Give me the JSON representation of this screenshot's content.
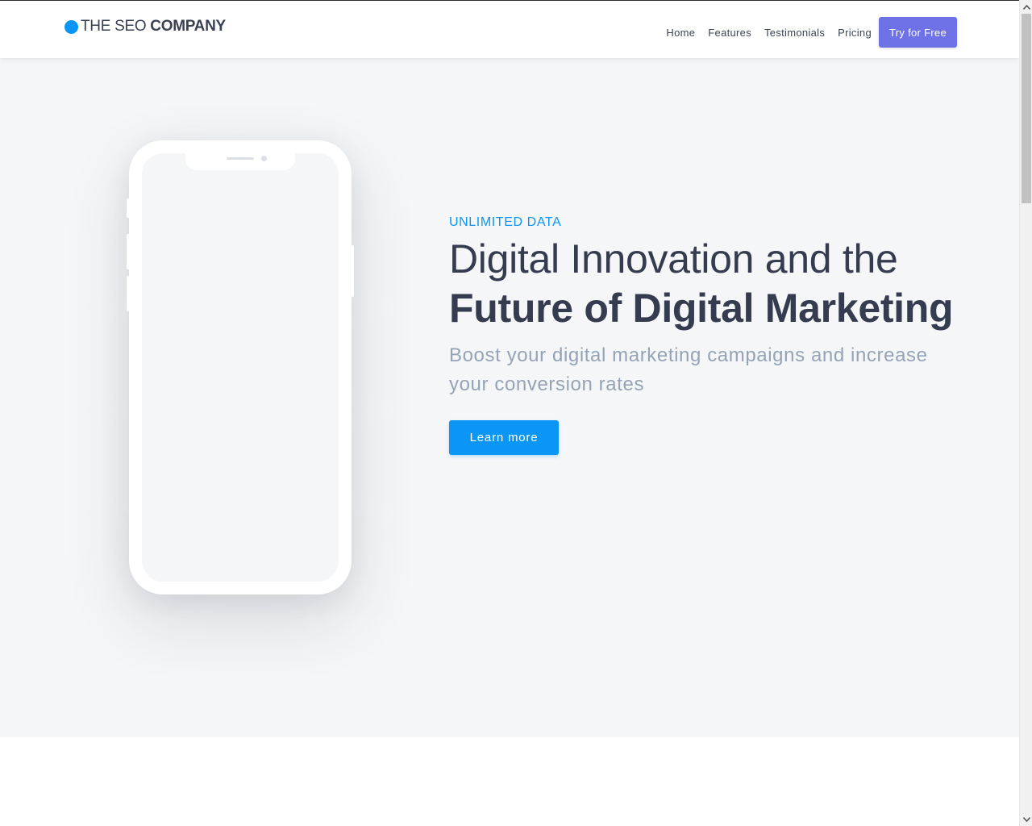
{
  "brand": {
    "name_regular": "THE SEO ",
    "name_bold": "COMPANY",
    "dot_color": "#0b95f4",
    "icon": "logo-dot-icon"
  },
  "nav": {
    "items": [
      {
        "label": "Home"
      },
      {
        "label": "Features"
      },
      {
        "label": "Testimonials"
      },
      {
        "label": "Pricing"
      }
    ],
    "cta_label": "Try for Free",
    "cta_color": "#6e72e6"
  },
  "hero": {
    "eyebrow": "UNLIMITED DATA",
    "headline_line1": "Digital Innovation and the",
    "headline_line2": "Future of Digital Marketing",
    "lead": "Boost your digital marketing campaigns and increase your conversion rates",
    "button_label": "Learn more",
    "accent_color": "#0b95f4",
    "background_color": "#f5f6f8",
    "illustration": "phone-mockup"
  },
  "scrollbar": {
    "up_icon": "chevron-up-icon",
    "down_icon": "chevron-down-icon"
  }
}
